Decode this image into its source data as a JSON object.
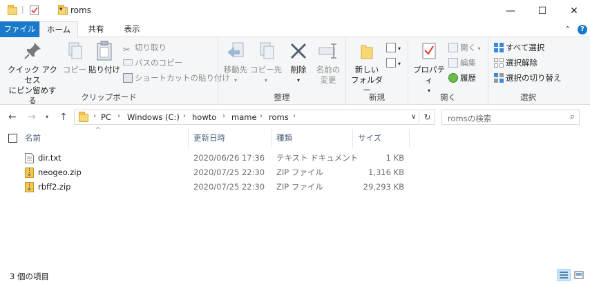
{
  "window": {
    "title": "roms",
    "controls": {
      "minimize": "—",
      "maximize": "☐",
      "close": "✕"
    }
  },
  "tabs": [
    {
      "label": "ファイル"
    },
    {
      "label": "ホーム"
    },
    {
      "label": "共有"
    },
    {
      "label": "表示"
    }
  ],
  "ribbon": {
    "clipboard": {
      "label": "クリップボード",
      "pin_line1": "クイック アクセス",
      "pin_line2": "にピン留めする",
      "copy": "コピー",
      "paste": "貼り付け",
      "cut": "切り取り",
      "copy_path": "パスのコピー",
      "paste_shortcut": "ショートカットの貼り付け"
    },
    "organize": {
      "label": "整理",
      "move_to": "移動先",
      "copy_to": "コピー先",
      "delete": "削除",
      "rename_line1": "名前の",
      "rename_line2": "変更"
    },
    "new": {
      "label": "新規",
      "new_folder_line1": "新しい",
      "new_folder_line2": "フォルダー"
    },
    "open": {
      "label": "開く",
      "properties": "プロパティ",
      "open": "開く",
      "edit": "編集",
      "history": "履歴"
    },
    "select": {
      "label": "選択",
      "select_all": "すべて選択",
      "select_none": "選択解除",
      "invert": "選択の切り替え"
    }
  },
  "address": {
    "crumbs": [
      "PC",
      "Windows (C:)",
      "howto",
      "mame",
      "roms"
    ],
    "search_placeholder": "romsの検索"
  },
  "columns": {
    "name": "名前",
    "modified": "更新日時",
    "type": "種類",
    "size": "サイズ"
  },
  "files": [
    {
      "name": "dir.txt",
      "modified": "2020/06/26 17:36",
      "type": "テキスト ドキュメント",
      "size": "1 KB",
      "icon": "text-file-icon"
    },
    {
      "name": "neogeo.zip",
      "modified": "2020/07/25 22:30",
      "type": "ZIP ファイル",
      "size": "1,316 KB",
      "icon": "zip-file-icon"
    },
    {
      "name": "rbff2.zip",
      "modified": "2020/07/25 22:30",
      "type": "ZIP ファイル",
      "size": "29,293 KB",
      "icon": "zip-file-icon"
    }
  ],
  "status": {
    "item_count": "3 個の項目"
  },
  "colors": {
    "accent": "#1979ca",
    "ribbon_bg": "#f5f6f7",
    "folder": "#f8d775"
  }
}
